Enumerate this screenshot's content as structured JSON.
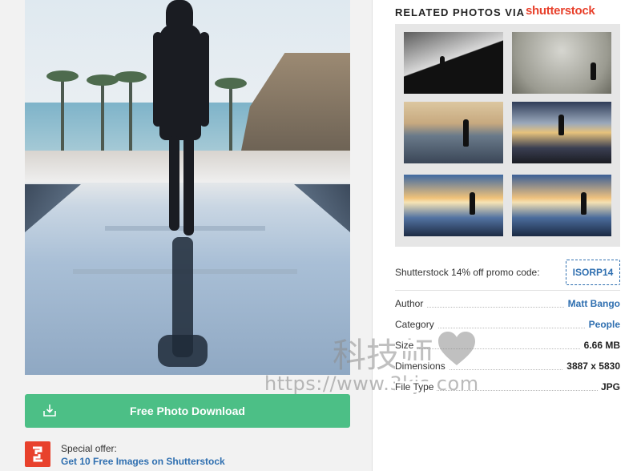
{
  "related": {
    "heading": "RELATED PHOTOS VIA",
    "brand": "shutterstock"
  },
  "download": {
    "label": "Free Photo Download"
  },
  "offer": {
    "title": "Special offer:",
    "link": "Get 10 Free Images on Shutterstock"
  },
  "promo": {
    "label": "Shutterstock 14% off promo code:",
    "code": "ISORP14"
  },
  "meta": [
    {
      "label": "Author",
      "value": "Matt Bango",
      "link": true
    },
    {
      "label": "Category",
      "value": "People",
      "link": true
    },
    {
      "label": "Size",
      "value": "6.66 MB",
      "link": false
    },
    {
      "label": "Dimensions",
      "value": "3887 x 5830",
      "link": false
    },
    {
      "label": "File Type",
      "value": "JPG",
      "link": false
    }
  ],
  "watermark": {
    "chinese": "科技师",
    "url": "https://www.3kjs.com"
  },
  "colors": {
    "download_button": "#4cbf86",
    "link": "#2f6fb0",
    "brand_red": "#e8412c"
  }
}
